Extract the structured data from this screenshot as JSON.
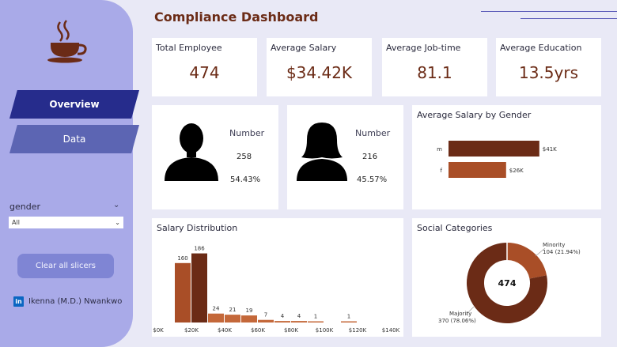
{
  "title": "Compliance Dashboard",
  "nav": {
    "overview": "Overview",
    "data": "Data"
  },
  "slicer": {
    "label": "gender",
    "value": "All"
  },
  "clear_label": "Clear all slicers",
  "credit": "Ikenna (M.D.) Nwankwo",
  "kpis": [
    {
      "label": "Total Employee",
      "value": "474"
    },
    {
      "label": "Average Salary",
      "value": "$34.42K"
    },
    {
      "label": "Average Job-time",
      "value": "81.1"
    },
    {
      "label": "Average Education",
      "value": "13.5yrs"
    }
  ],
  "male": {
    "label": "Number",
    "count": "258",
    "pct": "54.43%"
  },
  "female": {
    "label": "Number",
    "count": "216",
    "pct": "45.57%"
  },
  "colors": {
    "dark": "#6b2b16",
    "mid": "#a94e27",
    "light": "#c4683a",
    "sidebar": "#a9aae8"
  },
  "chart_data": [
    {
      "type": "bar",
      "title": "Average Salary by Gender",
      "orientation": "horizontal",
      "categories": [
        "m",
        "f"
      ],
      "values": [
        41,
        26
      ],
      "value_labels": [
        "$41K",
        "$26K"
      ],
      "xlim": [
        0,
        50
      ]
    },
    {
      "type": "bar",
      "title": "Salary Distribution",
      "x_ticks": [
        "$0K",
        "$20K",
        "$40K",
        "$60K",
        "$80K",
        "$100K",
        "$120K",
        "$140K"
      ],
      "bin_start": 10,
      "bin_width": 10,
      "values": [
        160,
        186,
        24,
        21,
        19,
        7,
        4,
        4,
        1,
        0,
        1
      ],
      "value_labels": [
        "160",
        "186",
        "24",
        "21",
        "19",
        "7",
        "4",
        "4",
        "1",
        "",
        "1"
      ],
      "xlim": [
        0,
        140
      ],
      "ylim": [
        0,
        200
      ]
    },
    {
      "type": "pie",
      "title": "Social Categories",
      "donut": true,
      "center_label": "474",
      "slices": [
        {
          "name": "Minority",
          "value": 104,
          "label": "104 (21.94%)"
        },
        {
          "name": "Majority",
          "value": 370,
          "label": "370 (78.06%)"
        }
      ]
    }
  ]
}
